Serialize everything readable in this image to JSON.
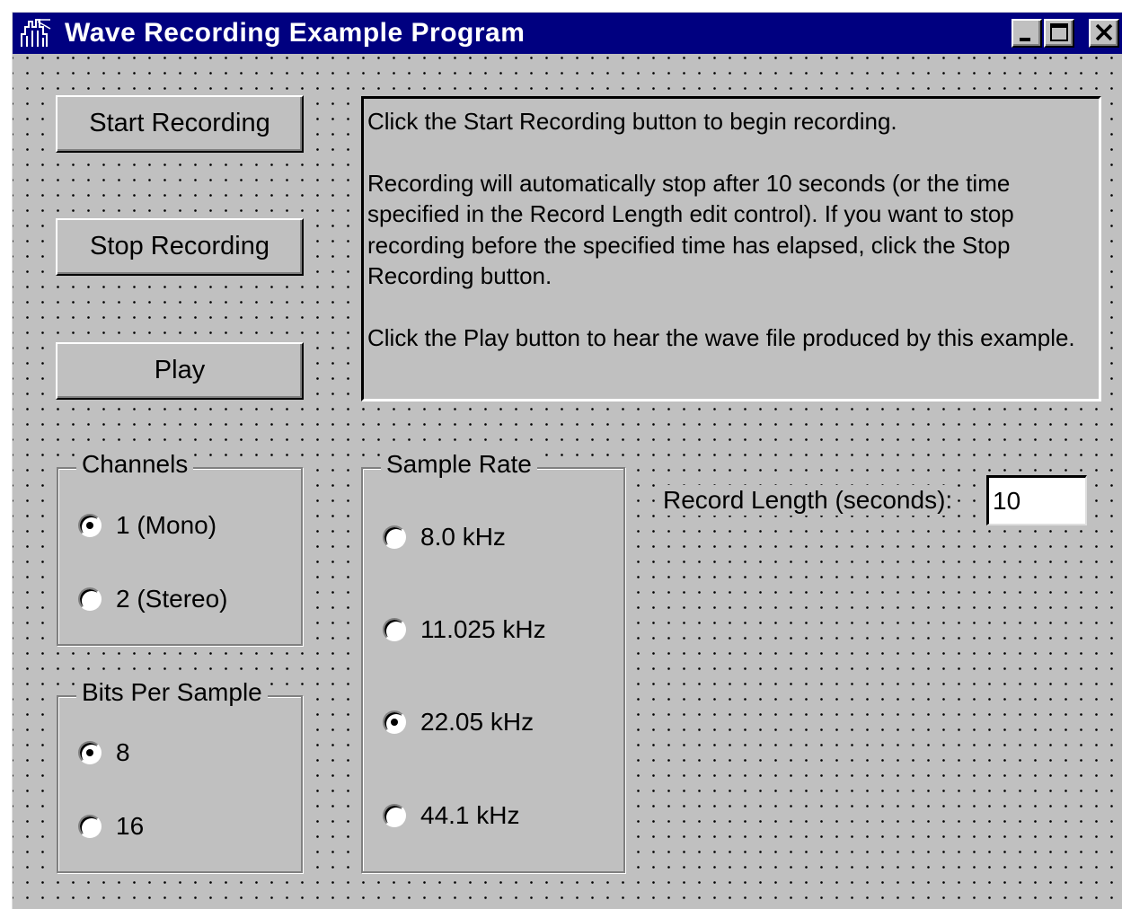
{
  "window": {
    "title": "Wave Recording Example Program",
    "icon": "app-icon",
    "controls": {
      "minimize": "minimize-icon",
      "maximize": "maximize-icon",
      "close": "close-icon"
    }
  },
  "buttons": {
    "start": "Start Recording",
    "stop": "Stop Recording",
    "play": "Play"
  },
  "info": {
    "p1": "Click the Start Recording button to begin recording.",
    "p2": "Recording will automatically stop after 10 seconds (or the time specified in the Record Length edit control). If you want to stop recording before the specified time has elapsed, click the Stop Recording button.",
    "p3": "Click the Play button to hear the wave file produced by this example."
  },
  "channels": {
    "title": "Channels",
    "options": [
      {
        "label": "1 (Mono)",
        "selected": true
      },
      {
        "label": "2 (Stereo)",
        "selected": false
      }
    ]
  },
  "bits": {
    "title": "Bits Per Sample",
    "options": [
      {
        "label": "8",
        "selected": true
      },
      {
        "label": "16",
        "selected": false
      }
    ]
  },
  "sample_rate": {
    "title": "Sample Rate",
    "options": [
      {
        "label": "8.0 kHz",
        "selected": false
      },
      {
        "label": "11.025 kHz",
        "selected": false
      },
      {
        "label": "22.05 kHz",
        "selected": true
      },
      {
        "label": "44.1 kHz",
        "selected": false
      }
    ]
  },
  "record_length": {
    "label": "Record Length (seconds):",
    "value": "10"
  },
  "colors": {
    "titlebar": "#000080",
    "face": "#c0c0c0"
  }
}
